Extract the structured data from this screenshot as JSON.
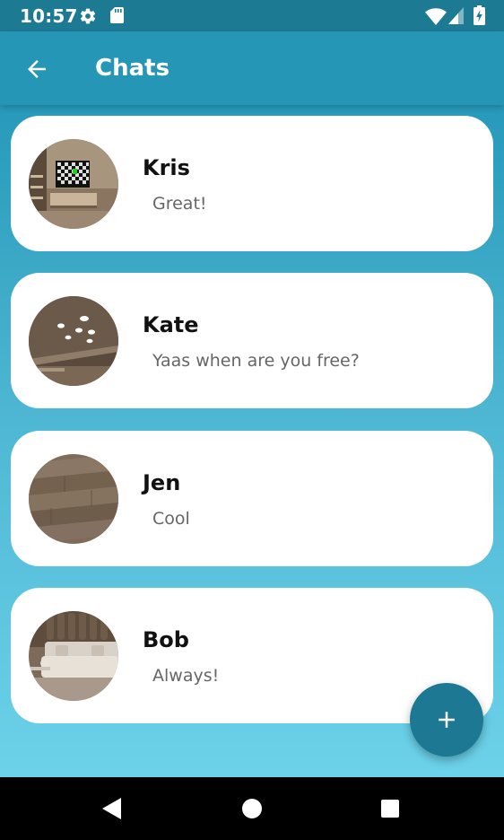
{
  "status_bar": {
    "time": "10:57",
    "icons": [
      "gear-icon",
      "sd-card-icon",
      "wifi-icon",
      "signal-icon",
      "battery-charging-icon"
    ]
  },
  "app_bar": {
    "back_icon": "arrow-left-icon",
    "title": "Chats"
  },
  "chats": [
    {
      "name": "Kris",
      "last_message": "Great!",
      "avatar_icon": "avatar-photo-tv-room"
    },
    {
      "name": "Kate",
      "last_message": "Yaas when are you free?",
      "avatar_icon": "avatar-photo-ceiling-lights"
    },
    {
      "name": "Jen",
      "last_message": "Cool",
      "avatar_icon": "avatar-photo-wood-floor"
    },
    {
      "name": "Bob",
      "last_message": "Always!",
      "avatar_icon": "avatar-photo-sofa"
    }
  ],
  "fab": {
    "icon": "plus-icon"
  },
  "nav_bar": {
    "icons": [
      "nav-back-icon",
      "nav-home-icon",
      "nav-recents-icon"
    ]
  },
  "colors": {
    "status_bar": "#1d7a93",
    "app_bar": "#2596b5",
    "content_gradient_top": "#2799ba",
    "content_gradient_bottom": "#6cd2ea",
    "card": "#ffffff",
    "fab": "#1c7893",
    "message_text": "#666666"
  }
}
